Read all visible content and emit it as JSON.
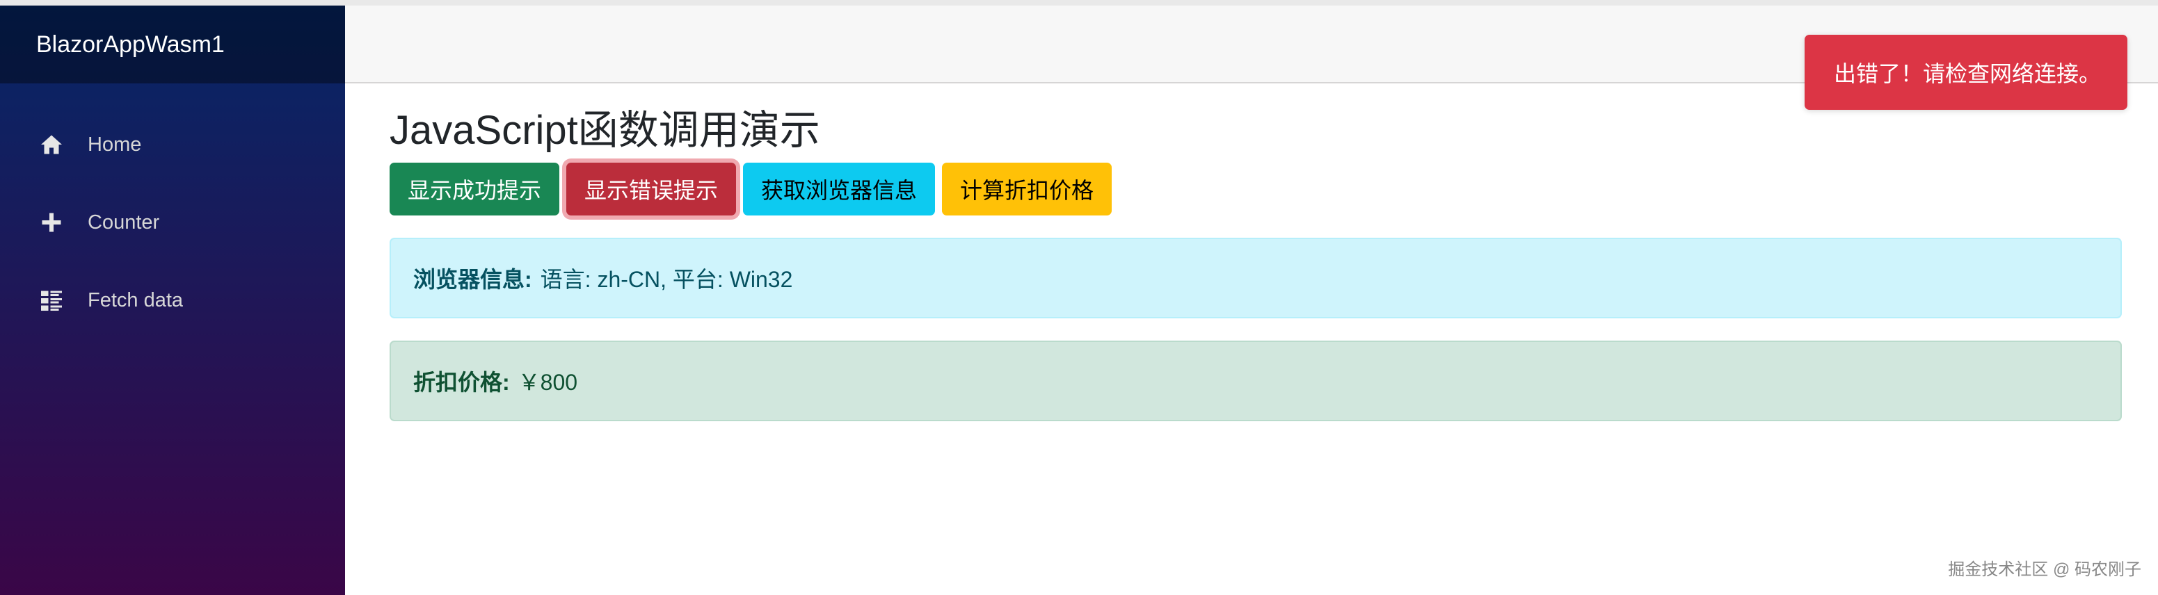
{
  "sidebar": {
    "brand": "BlazorAppWasm1",
    "items": [
      {
        "label": "Home",
        "icon": "home-icon"
      },
      {
        "label": "Counter",
        "icon": "plus-icon"
      },
      {
        "label": "Fetch data",
        "icon": "list-icon"
      }
    ]
  },
  "main": {
    "title": "JavaScript函数调用演示",
    "buttons": {
      "success": "显示成功提示",
      "error": "显示错误提示",
      "browser_info": "获取浏览器信息",
      "discount": "计算折扣价格"
    },
    "browser_alert": {
      "label": "浏览器信息:",
      "value": "语言: zh-CN, 平台: Win32"
    },
    "discount_alert": {
      "label": "折扣价格:",
      "value": "￥800"
    }
  },
  "toast": {
    "message": "出错了！请检查网络连接。"
  },
  "watermark": "掘金技术社区 @ 码农刚子",
  "colors": {
    "success": "#198754",
    "danger": "#dc3545",
    "info": "#0dcaf0",
    "warning": "#ffc107"
  }
}
